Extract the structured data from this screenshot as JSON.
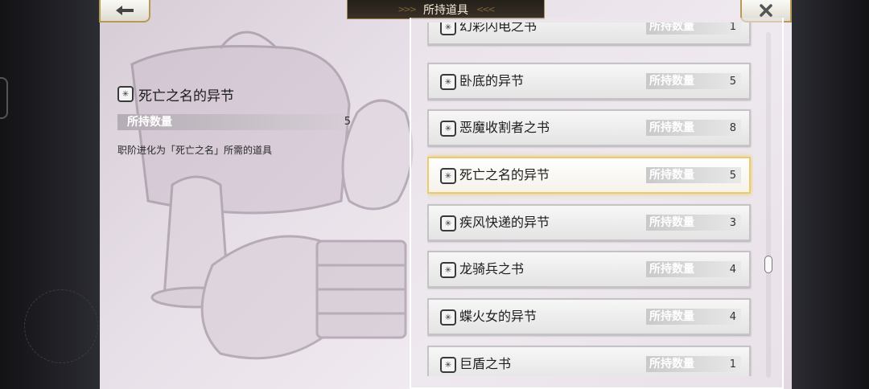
{
  "header": {
    "title": "所持道具"
  },
  "detail": {
    "name": "死亡之名的异节",
    "qty_label": "所持数量",
    "qty_value": "5",
    "description": "职阶进化为「死亡之名」所需的道具"
  },
  "items": [
    {
      "name": "幻彩闪电之书",
      "qty_label": "所持数量",
      "qty": "1"
    },
    {
      "name": "卧底的异节",
      "qty_label": "所持数量",
      "qty": "5"
    },
    {
      "name": "恶魔收割者之书",
      "qty_label": "所持数量",
      "qty": "8"
    },
    {
      "name": "死亡之名的异节",
      "qty_label": "所持数量",
      "qty": "5",
      "selected": true
    },
    {
      "name": "疾风快递的异节",
      "qty_label": "所持数量",
      "qty": "3"
    },
    {
      "name": "龙骑兵之书",
      "qty_label": "所持数量",
      "qty": "4"
    },
    {
      "name": "蝶火女的异节",
      "qty_label": "所持数量",
      "qty": "4"
    },
    {
      "name": "巨盾之书",
      "qty_label": "所持数量",
      "qty": "1"
    }
  ],
  "icons": {
    "back": "arrow-left-icon",
    "close": "close-icon",
    "item": "book-icon"
  }
}
